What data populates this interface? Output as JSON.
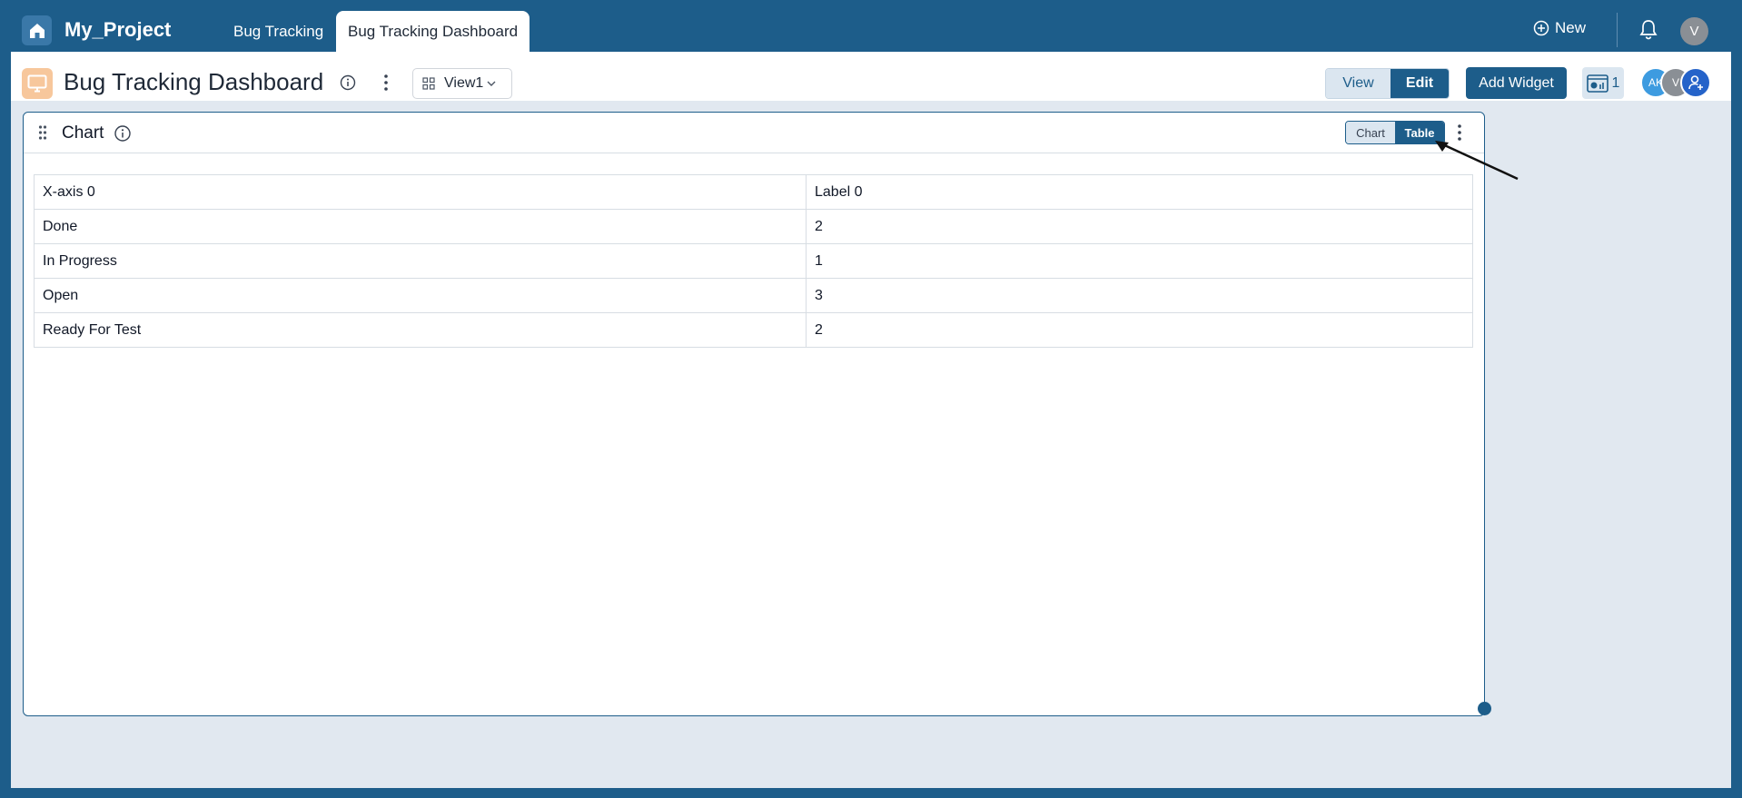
{
  "topbar": {
    "project_name": "My_Project",
    "tabs": [
      {
        "label": "Bug Tracking"
      },
      {
        "label": "Bug Tracking Dashboard"
      }
    ],
    "new_label": "New",
    "user_initial": "V"
  },
  "header": {
    "title": "Bug Tracking Dashboard",
    "view_select": "View1",
    "view_label": "View",
    "edit_label": "Edit",
    "add_widget_label": "Add Widget",
    "widget_count": "1",
    "avatars": [
      "AK",
      "V"
    ]
  },
  "widget": {
    "title": "Chart",
    "toggle_chart": "Chart",
    "toggle_table": "Table",
    "table": {
      "headers": [
        "X-axis 0",
        "Label 0"
      ],
      "rows": [
        [
          "Done",
          "2"
        ],
        [
          "In Progress",
          "1"
        ],
        [
          "Open",
          "3"
        ],
        [
          "Ready For Test",
          "2"
        ]
      ]
    }
  },
  "colors": {
    "brand": "#1d5d8a",
    "background": "#e1e8f0",
    "dashboard_icon": "#f7c79c"
  }
}
